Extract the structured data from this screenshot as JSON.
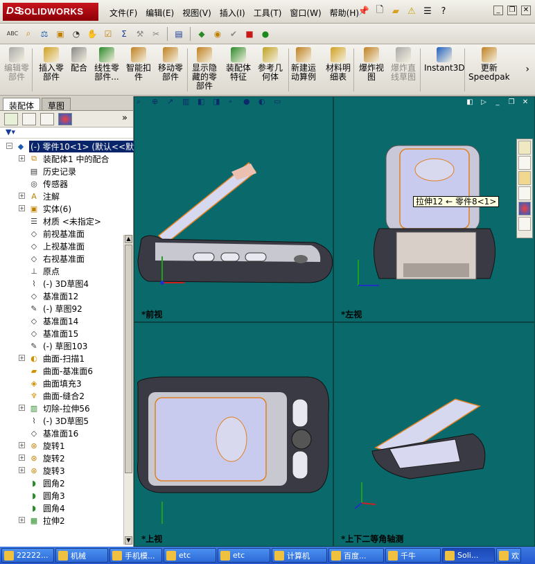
{
  "app": {
    "logo_ds": "DS",
    "logo_text": "SOLIDWORKS"
  },
  "menu": [
    "文件(F)",
    "编辑(E)",
    "视图(V)",
    "插入(I)",
    "工具(T)",
    "窗口(W)",
    "帮助(H)"
  ],
  "commands": [
    {
      "label": "编辑零\n部件",
      "disabled": true
    },
    {
      "label": "插入零\n部件",
      "disabled": false
    },
    {
      "label": "配合",
      "disabled": false
    },
    {
      "label": "线性零\n部件...",
      "disabled": false
    },
    {
      "label": "智能扣\n件",
      "disabled": false
    },
    {
      "label": "移动零\n部件",
      "disabled": false
    },
    {
      "label": "显示隐\n藏的零\n部件",
      "disabled": false
    },
    {
      "label": "装配体\n特征",
      "disabled": false
    },
    {
      "label": "参考几\n何体",
      "disabled": false
    },
    {
      "label": "新建运\n动算例",
      "disabled": false
    },
    {
      "label": "材料明\n细表",
      "disabled": false
    },
    {
      "label": "爆炸视\n图",
      "disabled": false
    },
    {
      "label": "爆炸直\n线草图",
      "disabled": true
    },
    {
      "label": "Instant3D",
      "disabled": false
    },
    {
      "label": "更新\nSpeedpak",
      "disabled": false
    }
  ],
  "feature_manager": {
    "tabs": [
      "装配体",
      "草图"
    ],
    "root": "(-) 零件10<1> (默认<<默",
    "items": [
      {
        "label": "装配体1 中的配合",
        "expand": true,
        "icon": "mates-icon"
      },
      {
        "label": "历史记录",
        "expand": false,
        "icon": "history-icon"
      },
      {
        "label": "传感器",
        "expand": false,
        "icon": "sensor-icon"
      },
      {
        "label": "注解",
        "expand": true,
        "icon": "annotation-icon"
      },
      {
        "label": "实体(6)",
        "expand": true,
        "icon": "solid-bodies-icon"
      },
      {
        "label": "材质 <未指定>",
        "expand": false,
        "icon": "material-icon"
      },
      {
        "label": "前视基准面",
        "expand": false,
        "icon": "plane-icon"
      },
      {
        "label": "上视基准面",
        "expand": false,
        "icon": "plane-icon"
      },
      {
        "label": "右视基准面",
        "expand": false,
        "icon": "plane-icon"
      },
      {
        "label": "原点",
        "expand": false,
        "icon": "origin-icon"
      },
      {
        "label": "(-) 3D草图4",
        "expand": false,
        "icon": "3d-sketch-icon"
      },
      {
        "label": "基准面12",
        "expand": false,
        "icon": "plane-icon"
      },
      {
        "label": "(-) 草图92",
        "expand": false,
        "icon": "sketch-icon"
      },
      {
        "label": "基准面14",
        "expand": false,
        "icon": "plane-icon"
      },
      {
        "label": "基准面15",
        "expand": false,
        "icon": "plane-icon"
      },
      {
        "label": "(-) 草图103",
        "expand": false,
        "icon": "sketch-icon"
      },
      {
        "label": "曲面-扫描1",
        "expand": true,
        "icon": "surface-sweep-icon"
      },
      {
        "label": "曲面-基准面6",
        "expand": false,
        "icon": "surface-plane-icon"
      },
      {
        "label": "曲面填充3",
        "expand": false,
        "icon": "surface-fill-icon"
      },
      {
        "label": "曲面-缝合2",
        "expand": false,
        "icon": "surface-knit-icon"
      },
      {
        "label": "切除-拉伸56",
        "expand": true,
        "icon": "cut-extrude-icon"
      },
      {
        "label": "(-) 3D草图5",
        "expand": false,
        "icon": "3d-sketch-icon"
      },
      {
        "label": "基准面16",
        "expand": false,
        "icon": "plane-icon"
      },
      {
        "label": "旋转1",
        "expand": true,
        "icon": "revolve-icon"
      },
      {
        "label": "旋转2",
        "expand": true,
        "icon": "revolve-icon"
      },
      {
        "label": "旋转3",
        "expand": true,
        "icon": "revolve-icon"
      },
      {
        "label": "圆角2",
        "expand": false,
        "icon": "fillet-icon"
      },
      {
        "label": "圆角3",
        "expand": false,
        "icon": "fillet-icon"
      },
      {
        "label": "圆角4",
        "expand": false,
        "icon": "fillet-icon"
      },
      {
        "label": "拉伸2",
        "expand": true,
        "icon": "extrude-icon"
      }
    ]
  },
  "views": {
    "front": "*前视",
    "left": "*左视",
    "top": "*上视",
    "dimetric": "*上下二等角轴测"
  },
  "tooltip": "拉伸12 ← 零件8<1>",
  "taskbar": [
    {
      "label": "22222...",
      "width": 76
    },
    {
      "label": "机械",
      "width": 76
    },
    {
      "label": "手机模...",
      "width": 76
    },
    {
      "label": "etc",
      "width": 76
    },
    {
      "label": "etc",
      "width": 76
    },
    {
      "label": "计算机",
      "width": 80
    },
    {
      "label": "百度...",
      "width": 80
    },
    {
      "label": "千牛",
      "width": 80
    },
    {
      "label": "Soli...",
      "width": 76
    },
    {
      "label": "欢",
      "width": 36
    }
  ],
  "colors": {
    "viewport_bg": "#0a6a6b",
    "selection": "#0a246a",
    "logo": "#b0121a"
  }
}
